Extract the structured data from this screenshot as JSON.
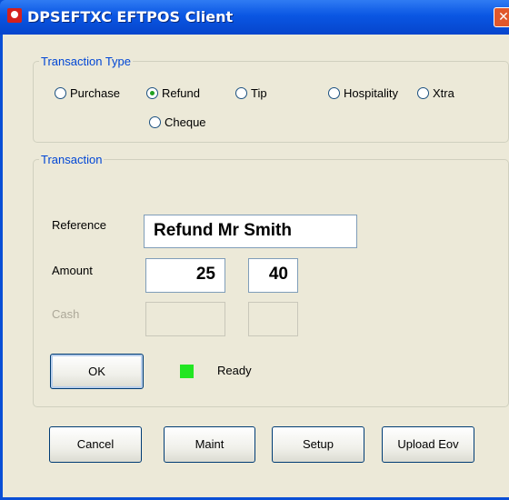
{
  "window": {
    "title": "DPSEFTXC EFTPOS Client",
    "close_symbol": "✕"
  },
  "transaction_type": {
    "legend": "Transaction Type",
    "options": [
      {
        "label": "Purchase",
        "selected": false
      },
      {
        "label": "Refund",
        "selected": true
      },
      {
        "label": "Tip",
        "selected": false
      },
      {
        "label": "Hospitality",
        "selected": false
      },
      {
        "label": "Xtra",
        "selected": false
      },
      {
        "label": "Cheque",
        "selected": false
      }
    ]
  },
  "transaction": {
    "legend": "Transaction",
    "reference_label": "Reference",
    "reference_value": "Refund Mr Smith",
    "amount_label": "Amount",
    "amount_dollars": "25",
    "amount_cents": "40",
    "cash_label": "Cash",
    "cash_dollars": "",
    "cash_cents": "",
    "ok_label": "OK",
    "status_text": "Ready",
    "status_color": "#22e622"
  },
  "footer_buttons": {
    "cancel": "Cancel",
    "maint": "Maint",
    "setup": "Setup",
    "upload_eov": "Upload Eov"
  }
}
